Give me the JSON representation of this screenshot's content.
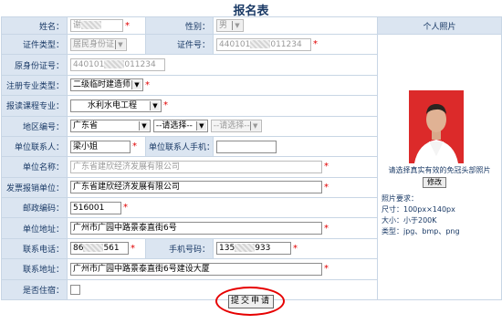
{
  "page": {
    "title": "报名表"
  },
  "form": {
    "name": {
      "label": "姓名：",
      "value": "谢"
    },
    "gender": {
      "label": "性别：",
      "value": "男"
    },
    "id_type": {
      "label": "证件类型：",
      "value": "居民身份证"
    },
    "id_number": {
      "label": "证件号：",
      "value_prefix": "440101",
      "value_suffix": "011234"
    },
    "orig_id": {
      "label": "原身份证号：",
      "value_prefix": "440101",
      "value_suffix": "011234"
    },
    "major_type": {
      "label": "注册专业类型：",
      "value": "二级临时建造师"
    },
    "course": {
      "label": "报读课程专业：",
      "value": "水利水电工程"
    },
    "region": {
      "label": "地区编号：",
      "province": "广东省",
      "city": "--请选择--",
      "district": "--请选择--"
    },
    "contact": {
      "label": "单位联系人：",
      "value": "梁小姐",
      "phone_label": "单位联系人手机：",
      "phone_value": ""
    },
    "org_name": {
      "label": "单位名称：",
      "value": "广东省建欣经济发展有限公司"
    },
    "invoice_org": {
      "label": "发票报销单位：",
      "value": "广东省建欣经济发展有限公司"
    },
    "postcode": {
      "label": "邮政编码：",
      "value": "516001"
    },
    "org_address": {
      "label": "单位地址：",
      "value": "广州市广园中路景泰直街6号"
    },
    "tel": {
      "label": "联系电话：",
      "prefix": "86",
      "suffix": "561"
    },
    "mobile": {
      "label": "手机号码：",
      "prefix": "135",
      "suffix": "933"
    },
    "contact_address": {
      "label": "联系地址：",
      "value": "广州市广园中路景泰直街6号建设大厦"
    },
    "lodging": {
      "label": "是否住宿：",
      "checked": false
    }
  },
  "photo": {
    "header": "个人照片",
    "hint": "请选择真实有效的免冠头部照片",
    "modify_label": "修改",
    "req_title": "照片要求：",
    "req_size": "尺寸：100px×140px",
    "req_filesize": "大小：小于200K",
    "req_type": "类型：jpg、bmp、png"
  },
  "submit_label": "提交申请",
  "required_mark": "*"
}
